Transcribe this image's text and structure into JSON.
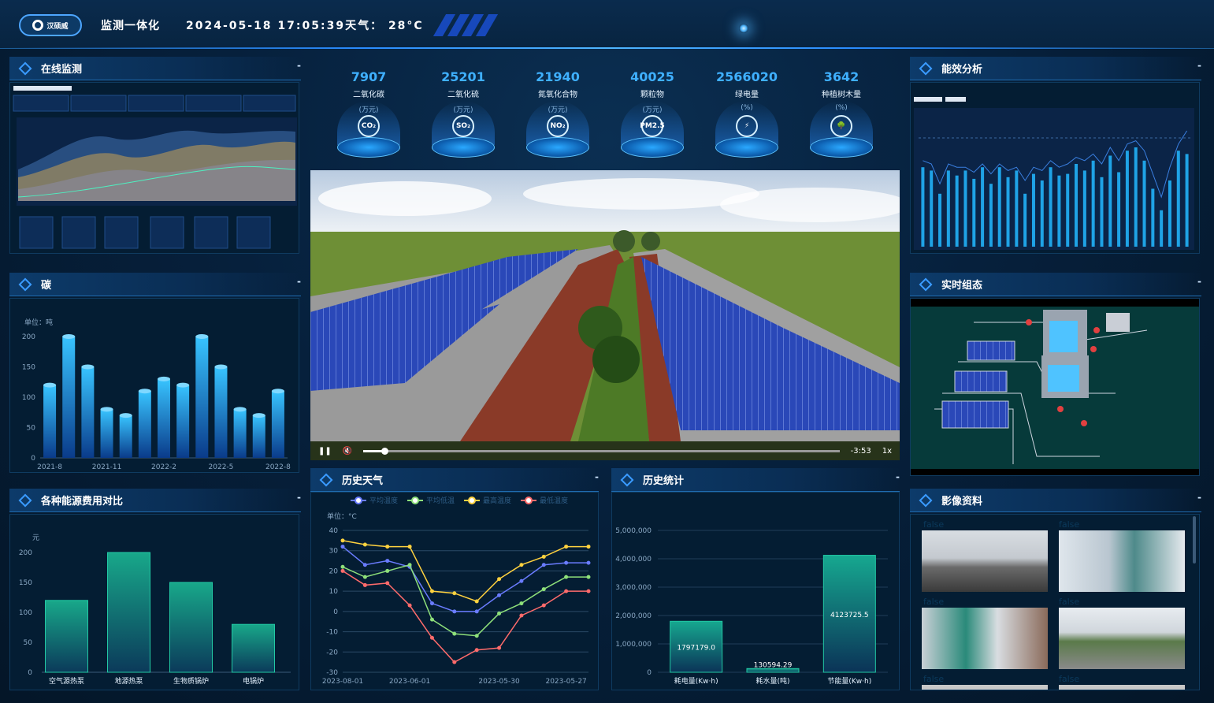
{
  "header": {
    "logo_text": "汉硕威",
    "title": "监测一体化",
    "datetime": "2024-05-18 17:05:39天气： 28°C"
  },
  "panels": {
    "online": {
      "title": "在线监测",
      "minimize": "-"
    },
    "carbon": {
      "title": "碳",
      "minimize": "-"
    },
    "energy_cost": {
      "title": "各种能源费用对比",
      "minimize": "-"
    },
    "efficiency": {
      "title": "能效分析",
      "minimize": "-"
    },
    "realtime": {
      "title": "实时组态",
      "minimize": "-"
    },
    "images": {
      "title": "影像资料",
      "minimize": "-"
    },
    "weather": {
      "title": "历史天气",
      "minimize": "-"
    },
    "history": {
      "title": "历史统计",
      "minimize": "-"
    }
  },
  "stats": [
    {
      "value": "7907",
      "label": "二氧化碳",
      "unit": "(万元)",
      "icon": "co2-cloud-icon",
      "glyph": "CO₂"
    },
    {
      "value": "25201",
      "label": "二氧化硫",
      "unit": "(万元)",
      "icon": "so2-icon",
      "glyph": "SO₂"
    },
    {
      "value": "21940",
      "label": "氮氧化合物",
      "unit": "(万元)",
      "icon": "nox-cloud-icon",
      "glyph": "NO₂"
    },
    {
      "value": "40025",
      "label": "颗粒物",
      "unit": "(万元)",
      "icon": "pm25-icon",
      "glyph": "PM2.5"
    },
    {
      "value": "2566020",
      "label": "绿电量",
      "unit": "(%)",
      "icon": "lightning-icon",
      "glyph": "⚡"
    },
    {
      "value": "3642",
      "label": "种植树木量",
      "unit": "(%)",
      "icon": "tree-icon",
      "glyph": "🌳"
    }
  ],
  "video": {
    "time": "-3:53",
    "speed": "1x",
    "progress": 0.045
  },
  "images": {
    "placeholder_labels": [
      "false",
      "false",
      "false",
      "false",
      "false",
      "false"
    ]
  },
  "chart_data": [
    {
      "id": "carbon",
      "type": "bar",
      "ylabel_text": "单位：吨",
      "ylim": [
        0,
        200
      ],
      "yticks": [
        0,
        50,
        100,
        150,
        200
      ],
      "xtick_labels": [
        "2021-8",
        "2021-11",
        "2022-2",
        "2022-5",
        "2022-8"
      ],
      "values": [
        120,
        200,
        150,
        80,
        70,
        110,
        130,
        120,
        200,
        150,
        80,
        70,
        110
      ],
      "colors": {
        "top": "#38c4ff",
        "bottom": "#0a3b8a"
      }
    },
    {
      "id": "energy_cost",
      "type": "bar",
      "ylabel_text": "元",
      "ylim": [
        0,
        200
      ],
      "yticks": [
        0,
        50,
        100,
        150,
        200
      ],
      "categories": [
        "空气源热泵",
        "地源热泵",
        "生物质锅炉",
        "电锅炉"
      ],
      "values": [
        120,
        200,
        150,
        80
      ],
      "colors": {
        "top": "#18a88a",
        "bottom": "#0b3a5a"
      }
    },
    {
      "id": "weather",
      "type": "line",
      "ylabel_text": "单位：°C",
      "ylim": [
        -30,
        40
      ],
      "yticks": [
        -30,
        -20,
        -10,
        0,
        10,
        20,
        30,
        40
      ],
      "xtick_labels": [
        "2023-08-01",
        "2023-06-01",
        "2023-05-30",
        "2023-05-27"
      ],
      "series": [
        {
          "name": "平均温度",
          "color": "#6a7cff",
          "values": [
            32,
            23,
            25,
            22,
            4,
            0,
            0,
            8,
            15,
            23,
            24,
            24
          ]
        },
        {
          "name": "平均低温",
          "color": "#8ee07a",
          "values": [
            22,
            17,
            20,
            23,
            -4,
            -11,
            -12,
            -1,
            4,
            11,
            17,
            17
          ]
        },
        {
          "name": "最高温度",
          "color": "#ffd23f",
          "values": [
            35,
            33,
            32,
            32,
            10,
            9,
            5,
            16,
            23,
            27,
            32,
            32
          ]
        },
        {
          "name": "最低温度",
          "color": "#ff6b6b",
          "values": [
            20,
            13,
            14,
            3,
            -13,
            -25,
            -19,
            -18,
            -2,
            3,
            10,
            10
          ]
        }
      ]
    },
    {
      "id": "history",
      "type": "bar",
      "ylim": [
        0,
        5000000
      ],
      "yticks": [
        "0",
        "1,000,000",
        "2,000,000",
        "3,000,000",
        "4,000,000",
        "5,000,000"
      ],
      "categories": [
        "耗电量(Kw·h)",
        "耗水量(吨)",
        "节能量(Kw·h)"
      ],
      "values": [
        1797179.0,
        130594.29
      ],
      "value_labels": [
        "1797179.0",
        "130594.29",
        "4123725.5"
      ],
      "values_full": [
        1797179.0,
        130594.29,
        4123725.5
      ],
      "colors": {
        "top": "#16a890",
        "bottom": "#0b3357"
      }
    },
    {
      "id": "efficiency",
      "type": "bar",
      "series_values": [
        48,
        46,
        32,
        46,
        43,
        46,
        41,
        48,
        38,
        48,
        42,
        46,
        32,
        44,
        40,
        48,
        43,
        44,
        50,
        46,
        52,
        42,
        55,
        45,
        58,
        60,
        52,
        35,
        22,
        40,
        58,
        56
      ],
      "line_values": [
        52,
        50,
        38,
        50,
        48,
        48,
        45,
        50,
        44,
        50,
        46,
        48,
        40,
        48,
        46,
        52,
        48,
        50,
        54,
        52,
        56,
        50,
        60,
        52,
        62,
        64,
        58,
        44,
        30,
        48,
        62,
        70
      ],
      "colors": {
        "bar": "#1fa3e6",
        "line": "#3a7fe0"
      }
    }
  ]
}
